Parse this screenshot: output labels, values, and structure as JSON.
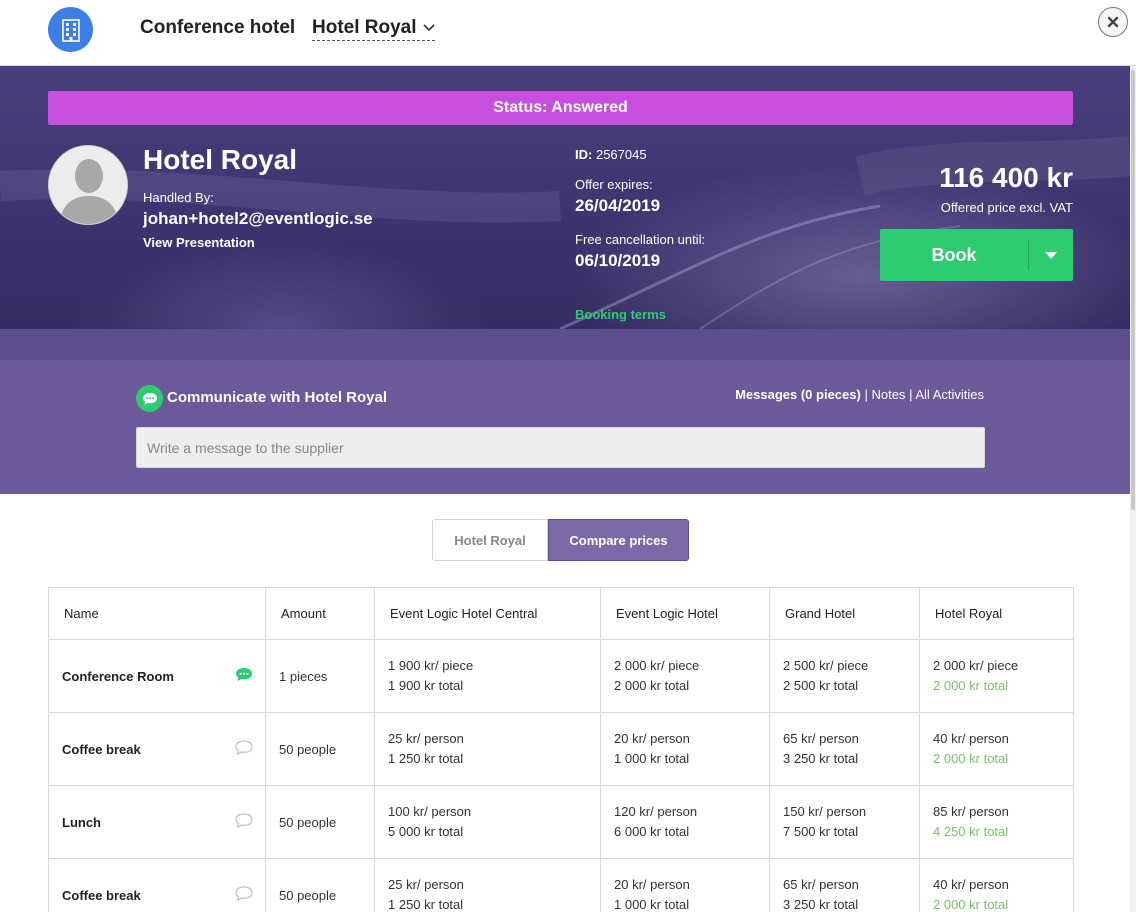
{
  "header": {
    "title": "Conference hotel",
    "hotel_select": "Hotel Royal"
  },
  "hero": {
    "status": "Status: Answered",
    "hotel_name": "Hotel Royal",
    "handled_by_label": "Handled By:",
    "handled_by_email": "johan+hotel2@eventlogic.se",
    "view_presentation": "View Presentation",
    "id_label": "ID:",
    "id_value": "2567045",
    "offer_expires_label": "Offer expires:",
    "offer_expires_value": "26/04/2019",
    "free_cancel_label": "Free cancellation until:",
    "free_cancel_value": "06/10/2019",
    "booking_terms": "Booking terms",
    "price": "116 400 kr",
    "price_label": "Offered price excl. VAT",
    "book_label": "Book"
  },
  "communicate": {
    "title": "Communicate with Hotel Royal",
    "messages": "Messages (0 pieces)",
    "sep": "|",
    "notes": "Notes",
    "all_activities": "All Activities",
    "placeholder": "Write a message to the supplier"
  },
  "toggle": {
    "left": "Hotel Royal",
    "right": "Compare prices"
  },
  "table": {
    "headers": [
      "Name",
      "Amount",
      "Event Logic Hotel Central",
      "Event Logic Hotel",
      "Grand Hotel",
      "Hotel Royal"
    ],
    "rows": [
      {
        "name": "Conference Room",
        "amount": "1 pieces",
        "c1": [
          "1 900 kr/ piece",
          "1 900 kr total"
        ],
        "c2": [
          "2 000 kr/ piece",
          "2 000 kr total"
        ],
        "c3": [
          "2 500 kr/ piece",
          "2 500 kr total"
        ],
        "c4": [
          "2 000 kr/ piece",
          "2 000 kr total"
        ]
      },
      {
        "name": "Coffee break",
        "amount": "50 people",
        "c1": [
          "25 kr/ person",
          "1 250 kr total"
        ],
        "c2": [
          "20 kr/ person",
          "1 000 kr total"
        ],
        "c3": [
          "65 kr/ person",
          "3 250 kr total"
        ],
        "c4": [
          "40 kr/ person",
          "2 000 kr total"
        ]
      },
      {
        "name": "Lunch",
        "amount": "50 people",
        "c1": [
          "100 kr/ person",
          "5 000 kr total"
        ],
        "c2": [
          "120 kr/ person",
          "6 000 kr total"
        ],
        "c3": [
          "150 kr/ person",
          "7 500 kr total"
        ],
        "c4": [
          "85 kr/ person",
          "4 250 kr total"
        ]
      },
      {
        "name": "Coffee break",
        "amount": "50 people",
        "c1": [
          "25 kr/ person",
          "1 250 kr total"
        ],
        "c2": [
          "20 kr/ person",
          "1 000 kr total"
        ],
        "c3": [
          "65 kr/ person",
          "3 250 kr total"
        ],
        "c4": [
          "40 kr/ person",
          "2 000 kr total"
        ]
      }
    ]
  },
  "colors": {
    "status": "#c64fe0",
    "book": "#2ecc71",
    "accent_purple": "#7b6aa6",
    "hotel_total_green": "#7cc16b"
  }
}
